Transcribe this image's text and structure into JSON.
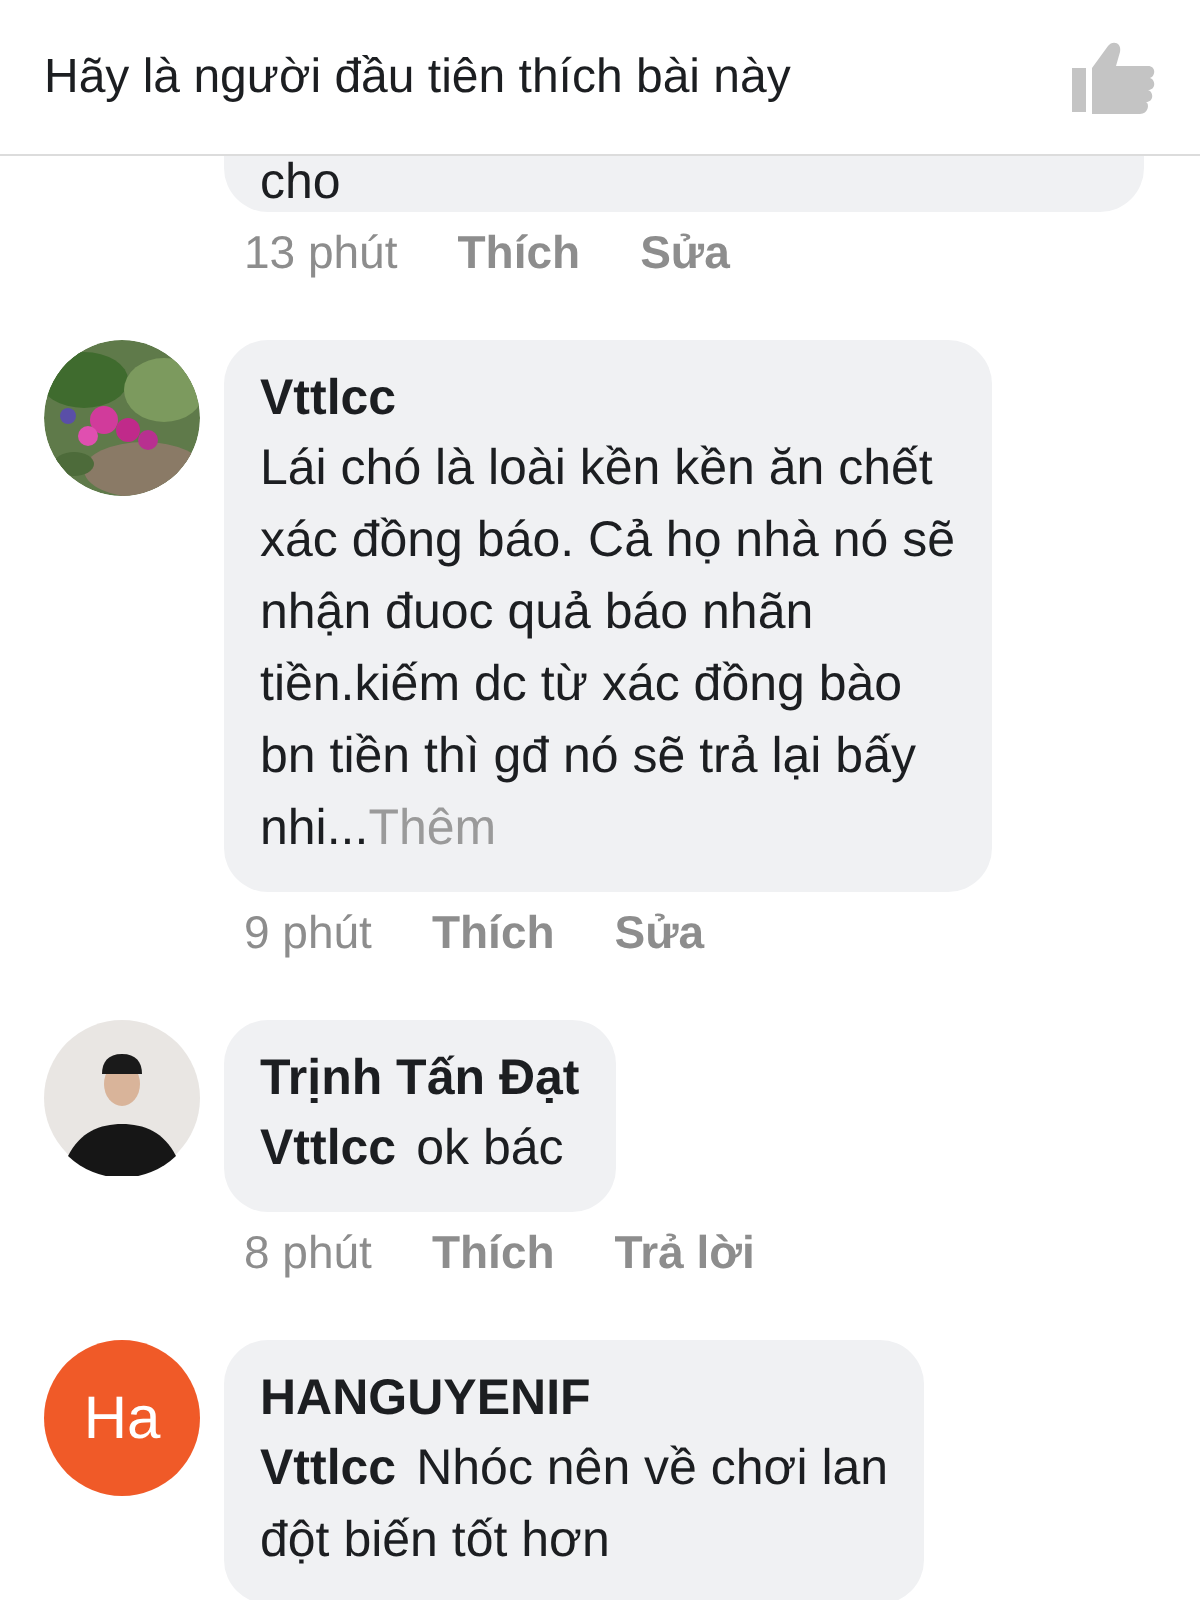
{
  "header": {
    "text": "Hãy là người đầu tiên thích bài này"
  },
  "comments": [
    {
      "avatar": {
        "kind": "none"
      },
      "partial": true,
      "lines": [
        "cho"
      ],
      "time": "13 phút",
      "actions": [
        "Thích",
        "Sửa"
      ]
    },
    {
      "name": "Vttlcc",
      "lines": [
        "Lái chó là loài kền kền ăn chết",
        "xác đồng báo. Cả họ nhà nó sẽ",
        "nhận đuoc quả báo nhãn",
        "tiền.kiếm dc từ xác đồng bào",
        "bn tiền thì gđ nó sẽ trả lại bấy",
        "nhi..."
      ],
      "more": "Thêm",
      "time": "9 phút",
      "actions": [
        "Thích",
        "Sửa"
      ]
    },
    {
      "avatar": {
        "kind": "person"
      },
      "name": "Trịnh Tấn Đạt",
      "mention": "Vttlcc",
      "lines": [
        "ok bác"
      ],
      "time": "8 phút",
      "actions": [
        "Thích",
        "Trả lời"
      ]
    },
    {
      "avatar": {
        "kind": "initials",
        "initials": "Ha",
        "color": "#f05a28"
      },
      "name": "HANGUYENIF",
      "mention": "Vttlcc",
      "lines": [
        "Nhóc nên về chơi lan",
        "đột biến tốt hơn"
      ]
    }
  ]
}
